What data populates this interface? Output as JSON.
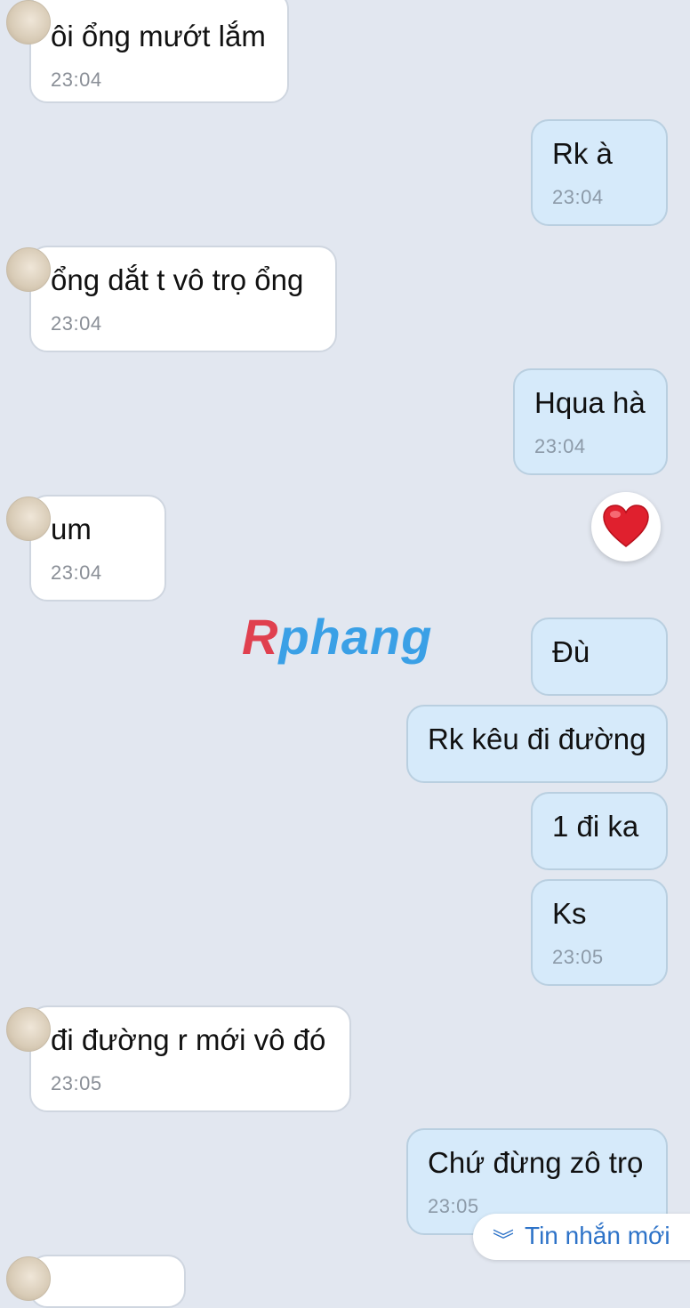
{
  "messages": [
    {
      "side": "in",
      "text": "ôi ổng mướt lắm",
      "time": "23:04"
    },
    {
      "side": "out",
      "text": "Rk à",
      "time": "23:04"
    },
    {
      "side": "in",
      "text": "ổng dắt t vô trọ ổng",
      "time": "23:04"
    },
    {
      "side": "out",
      "text": "Hqua hà",
      "time": "23:04"
    },
    {
      "side": "in",
      "text": "um",
      "time": "23:04"
    },
    {
      "side": "out",
      "text": "Đù",
      "time": ""
    },
    {
      "side": "out",
      "text": "Rk kêu đi đường",
      "time": ""
    },
    {
      "side": "out",
      "text": "1 đi ka",
      "time": ""
    },
    {
      "side": "out",
      "text": "Ks",
      "time": "23:05"
    },
    {
      "side": "in",
      "text": "đi đường r mới vô đó",
      "time": "23:05"
    },
    {
      "side": "out",
      "text": "Chứ đừng zô trọ",
      "time": "23:05"
    }
  ],
  "reaction": {
    "icon": "heart-icon",
    "color": "#e0202e"
  },
  "watermark": {
    "part1": "R",
    "part2": "phang"
  },
  "new_messages_button": {
    "icon": "double-chevron-down-icon",
    "label": "Tin nhắn mới"
  }
}
